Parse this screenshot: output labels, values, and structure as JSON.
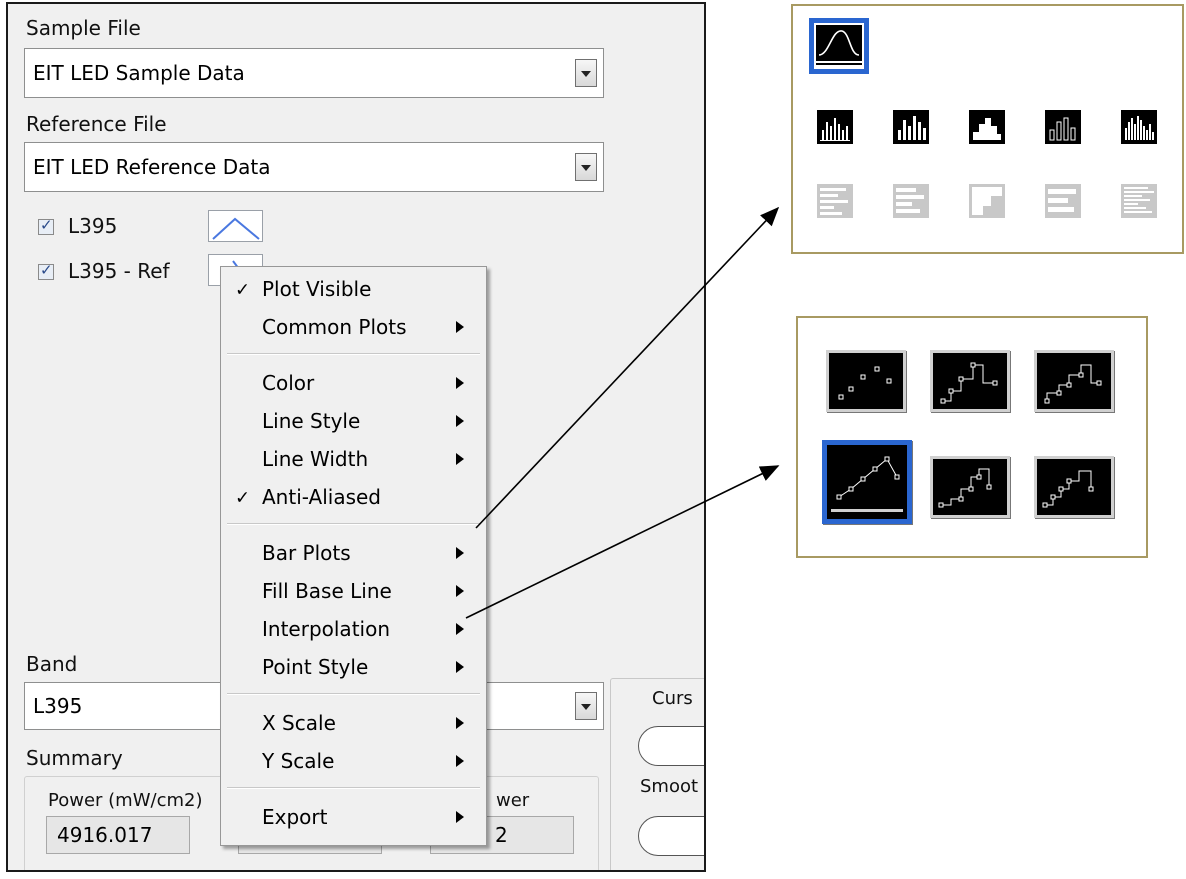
{
  "panel": {
    "sample_file_label": "Sample File",
    "sample_file_value": "EIT LED Sample Data",
    "reference_file_label": "Reference File",
    "reference_file_value": "EIT LED Reference Data",
    "plots": [
      {
        "name": "L395",
        "checked": true
      },
      {
        "name": "L395 - Ref",
        "checked": true
      }
    ],
    "band_label": "Band",
    "band_value": "L395",
    "summary_label": "Summary",
    "power_label": "Power (mW/cm2)",
    "power_value": "4916.017",
    "field2_value": "",
    "field3_label_partial": "wer",
    "field3_value_partial": "2",
    "cursor_label_partial": "Curs",
    "smooth_label_partial": "Smoot"
  },
  "menu": {
    "items": [
      {
        "label": "Plot Visible",
        "checked": true,
        "submenu": false
      },
      {
        "label": "Common Plots",
        "checked": false,
        "submenu": true
      },
      {
        "label": "Color",
        "checked": false,
        "submenu": true
      },
      {
        "label": "Line Style",
        "checked": false,
        "submenu": true
      },
      {
        "label": "Line Width",
        "checked": false,
        "submenu": true
      },
      {
        "label": "Anti-Aliased",
        "checked": true,
        "submenu": false
      },
      {
        "label": "Bar Plots",
        "checked": false,
        "submenu": true
      },
      {
        "label": "Fill Base Line",
        "checked": false,
        "submenu": true
      },
      {
        "label": "Interpolation",
        "checked": false,
        "submenu": true
      },
      {
        "label": "Point Style",
        "checked": false,
        "submenu": true
      },
      {
        "label": "X Scale",
        "checked": false,
        "submenu": true
      },
      {
        "label": "Y Scale",
        "checked": false,
        "submenu": true
      },
      {
        "label": "Export",
        "checked": false,
        "submenu": true
      }
    ],
    "check_glyph": "✓"
  },
  "bar_plots_palette": {
    "selected": "line-plot",
    "row1": [
      "bar-vertical-thin",
      "bar-vertical-mixed",
      "bar-vertical-filled",
      "bar-vertical-gaps",
      "bar-vertical-dense"
    ],
    "row2": [
      "bar-horizontal-thin",
      "bar-horizontal-mixed",
      "bar-horizontal-filled",
      "bar-horizontal-gaps",
      "bar-horizontal-dense"
    ]
  },
  "interpolation_palette": {
    "selected": "linear-interpolation",
    "options": [
      "points-only",
      "step-hv",
      "step-vh",
      "linear-interpolation",
      "step-centered-hv",
      "step-centered-vh"
    ]
  },
  "colors": {
    "selection_blue": "#2a66d0",
    "palette_border": "#a89a62",
    "plot_line": "#4a78e0"
  }
}
